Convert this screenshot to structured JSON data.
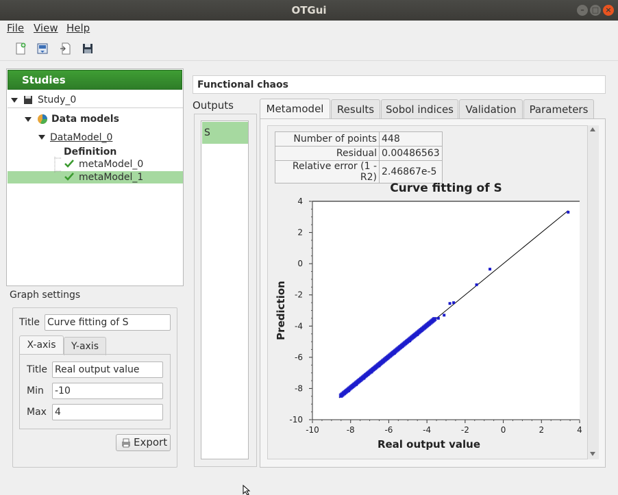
{
  "window": {
    "title": "OTGui"
  },
  "menu": {
    "file": "File",
    "view": "View",
    "help": "Help"
  },
  "toolbar": [
    "new-study-icon",
    "open-study-icon",
    "import-script-icon",
    "save-icon"
  ],
  "studies": {
    "header": "Studies",
    "tree": {
      "study": "Study_0",
      "data_models": "Data models",
      "data_model": "DataModel_0",
      "definition": "Definition",
      "meta_model_0": "metaModel_0",
      "meta_model_1": "metaModel_1"
    }
  },
  "graph_settings": {
    "label": "Graph settings",
    "title_label": "Title",
    "title_value": "Curve fitting of S",
    "tabs": [
      "X-axis",
      "Y-axis"
    ],
    "axis_title_label": "Title",
    "axis_title_value": "Real output value",
    "min_label": "Min",
    "min_value": "-10",
    "max_label": "Max",
    "max_value": "4",
    "export_label": "Export"
  },
  "analysis": {
    "title": "Functional chaos",
    "outputs_label": "Outputs",
    "outputs": [
      "S"
    ],
    "tabs": [
      "Metamodel",
      "Results",
      "Sobol indices",
      "Validation",
      "Parameters"
    ],
    "results_table": [
      {
        "key": "Number of points",
        "value": "448"
      },
      {
        "key": "Residual",
        "value": "0.00486563"
      },
      {
        "key": "Relative error (1 - R2)",
        "value": "2.46867e-5"
      }
    ]
  },
  "chart_data": {
    "type": "scatter",
    "title": "Curve fitting of S",
    "xlabel": "Real output value",
    "ylabel": "Prediction",
    "xlim": [
      -10,
      4
    ],
    "ylim": [
      -10,
      4
    ],
    "xticks": [
      -10,
      -8,
      -6,
      -4,
      -2,
      0,
      2,
      4
    ],
    "yticks": [
      4,
      2,
      0,
      -2,
      -4,
      -6,
      -8,
      -10
    ],
    "grid": false,
    "series": [
      {
        "type": "line",
        "x": [
          -8.6,
          3.4
        ],
        "y": [
          -8.6,
          3.4
        ]
      },
      {
        "type": "scatter",
        "x": [
          -8.5,
          -8.3,
          -8.1,
          -7.9,
          -7.7,
          -7.5,
          -7.3,
          -7.1,
          -6.9,
          -6.7,
          -6.5,
          -6.3,
          -6.1,
          -5.9,
          -5.7,
          -5.5,
          -5.3,
          -5.1,
          -4.9,
          -4.7,
          -4.5,
          -4.3,
          -4.1,
          -3.9,
          -3.7,
          -3.4,
          -3.1,
          -2.8,
          -2.6,
          -1.4,
          -0.7,
          3.4
        ],
        "y": [
          -8.5,
          -8.3,
          -8.15,
          -7.9,
          -7.75,
          -7.5,
          -7.35,
          -7.1,
          -6.95,
          -6.7,
          -6.55,
          -6.3,
          -6.1,
          -5.9,
          -5.75,
          -5.5,
          -5.3,
          -5.1,
          -4.95,
          -4.7,
          -4.55,
          -4.3,
          -4.1,
          -3.85,
          -3.7,
          -3.5,
          -3.3,
          -2.55,
          -2.5,
          -1.35,
          -0.35,
          3.3
        ],
        "color": "#1c1ccc"
      }
    ]
  }
}
